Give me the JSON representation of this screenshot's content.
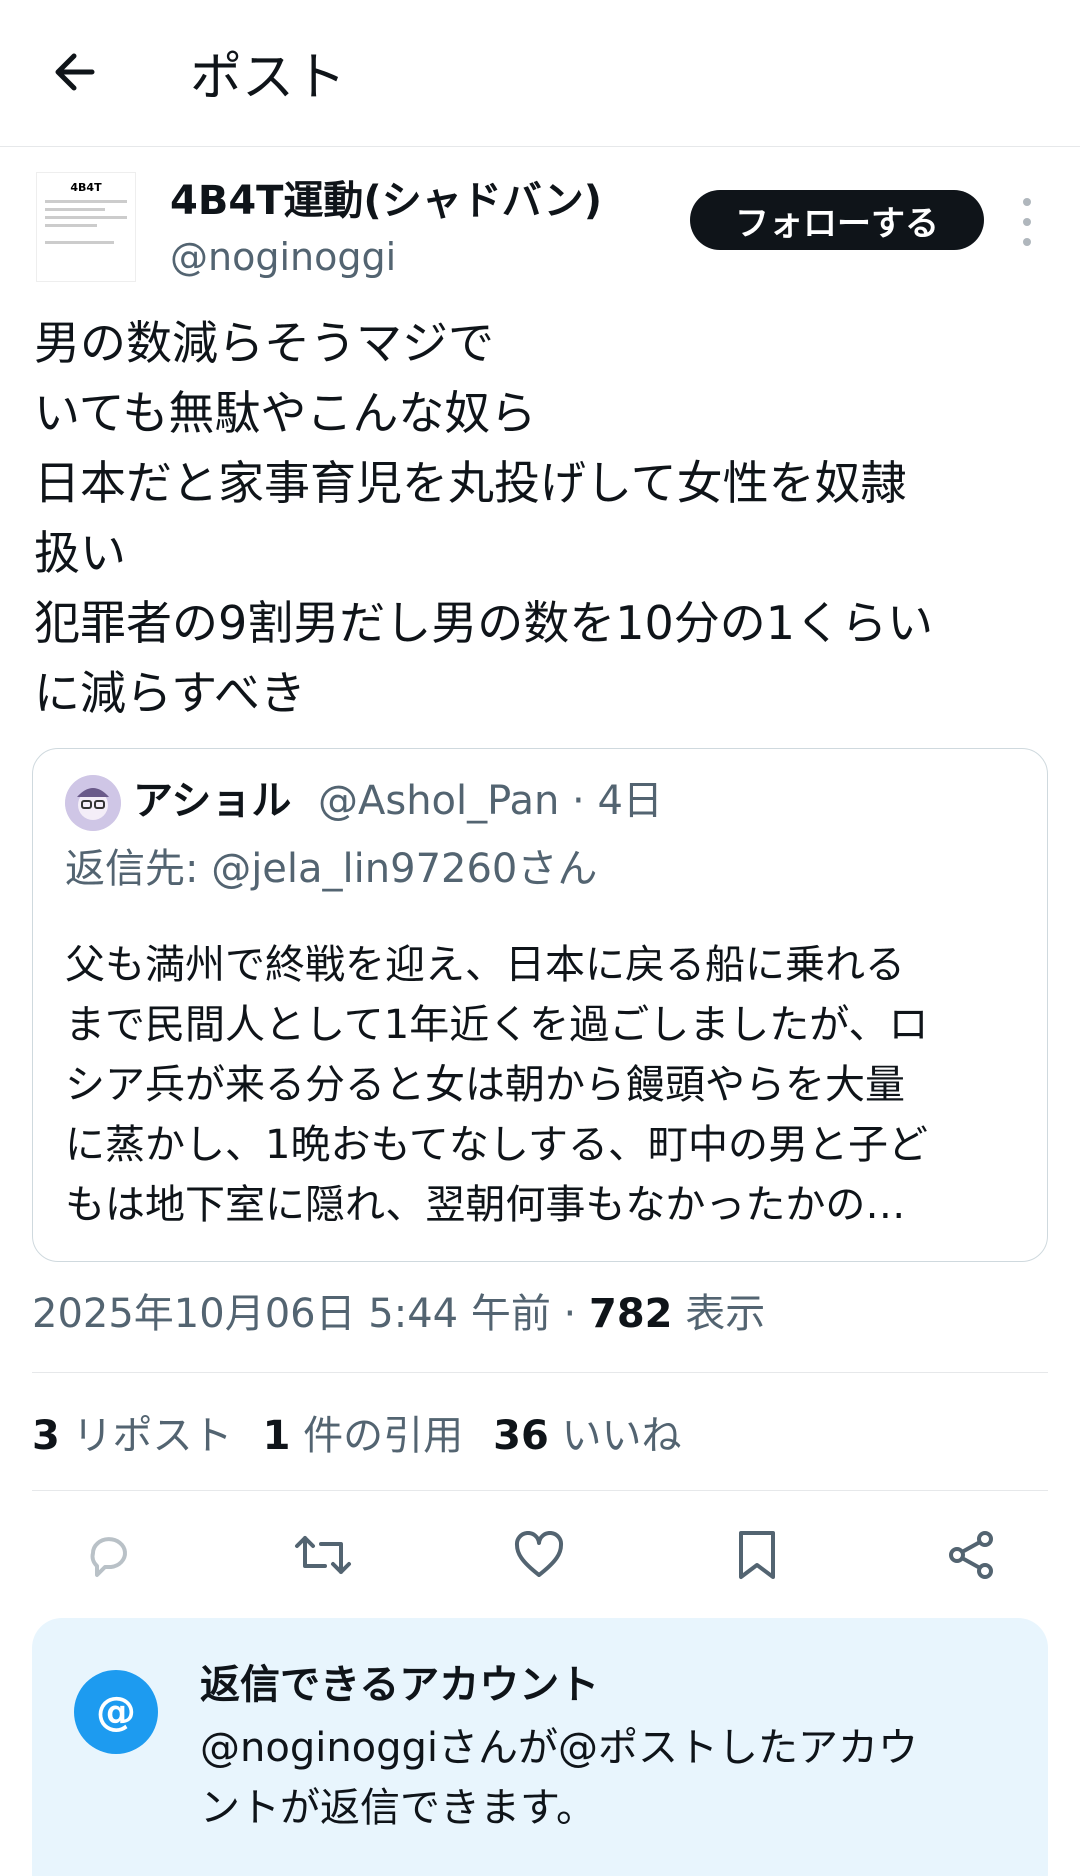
{
  "header": {
    "title": "ポスト"
  },
  "author": {
    "name": "4B4T運動(シャドバン)",
    "handle": "@noginoggi",
    "follow_label": "フォローする"
  },
  "post": {
    "lines": [
      "男の数減らそうマジで",
      "いても無駄やこんな奴ら",
      "日本だと家事育児を丸投げして女性を奴隷",
      "扱い",
      "犯罪者の9割男だし男の数を10分の1くらい",
      "に減らすべき"
    ]
  },
  "quote": {
    "name": "アショル",
    "handle_time": "@Ashol_Pan · 4日",
    "reply_to": "返信先: @jela_lin97260さん",
    "lines": [
      "父も満州で終戦を迎え、日本に戻る船に乗れる",
      "まで民間人として1年近くを過ごしましたが、ロ",
      "シア兵が来る分ると女は朝から饅頭やらを大量",
      "に蒸かし、1晩おもてなしする、町中の男と子ど",
      "もは地下室に隠れ、翌朝何事もなかったかの…"
    ]
  },
  "meta": {
    "datetime": "2025年10月06日 5:44 午前 · ",
    "views": "782",
    "views_label": " 表示"
  },
  "stats": {
    "reposts": "3",
    "reposts_label": " リポスト",
    "quotes": "1",
    "quotes_label": " 件の引用",
    "likes": "36",
    "likes_label": " いいね"
  },
  "reply_settings": {
    "icon": "@",
    "title": "返信できるアカウント",
    "desc_lines": [
      "@noginoggiさんが@ポストしたアカウ",
      "ントが返信できます。"
    ]
  },
  "colors": {
    "accent": "#1d9bf0",
    "text": "#0f1419",
    "muted": "#536471",
    "reply_bg": "#e8f5fd"
  }
}
